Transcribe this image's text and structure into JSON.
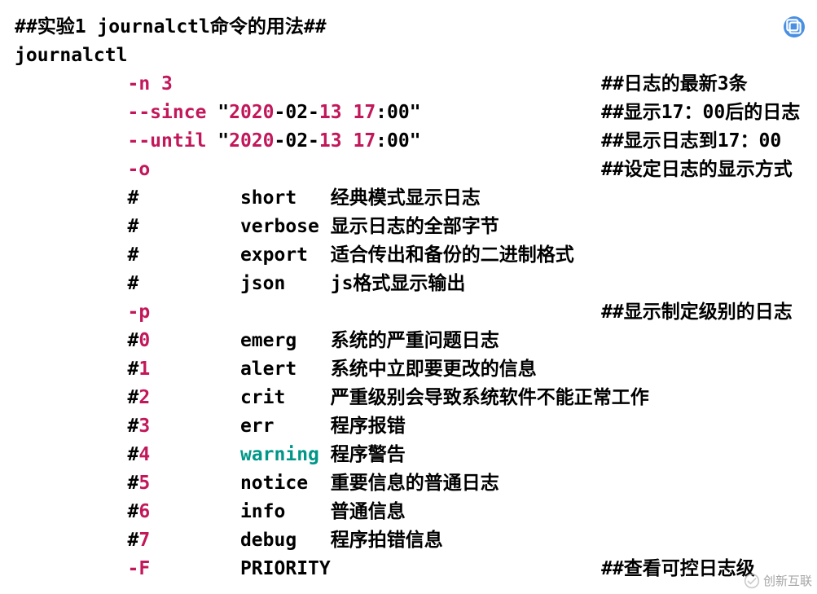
{
  "title_line": "##实验1 journalctl命令的用法##",
  "cmd": "journalctl",
  "indent": "          ",
  "col2_pad": "        ",
  "col3_start_pad": "",
  "rows": {
    "n": {
      "flag": "-n",
      "arg": "3",
      "comment": "##日志的最新3条"
    },
    "since": {
      "flag": "--since",
      "year": "2020",
      "mid": "-02-",
      "day": "13",
      "hour": "17",
      "rest": ":00",
      "comment": "##显示17：00后的日志"
    },
    "until": {
      "flag": "--until",
      "year": "2020",
      "mid": "-02-",
      "day": "13",
      "hour": "17",
      "rest": ":00",
      "comment": "##显示日志到17：00"
    },
    "o": {
      "flag": "-o",
      "comment": "##设定日志的显示方式"
    },
    "fmt": [
      {
        "key": "#",
        "name": "short",
        "desc": "经典模式显示日志"
      },
      {
        "key": "#",
        "name": "verbose",
        "desc": "显示日志的全部字节"
      },
      {
        "key": "#",
        "name": "export",
        "desc": "适合传出和备份的二进制格式"
      },
      {
        "key": "#",
        "name": "json",
        "desc": "js格式显示输出"
      }
    ],
    "p": {
      "flag": "-p",
      "comment": "##显示制定级别的日志"
    },
    "levels": [
      {
        "hash": "#",
        "num": "0",
        "name": "emerg",
        "desc": "系统的严重问题日志"
      },
      {
        "hash": "#",
        "num": "1",
        "name": "alert",
        "desc": "系统中立即要更改的信息"
      },
      {
        "hash": "#",
        "num": "2",
        "name": "crit",
        "desc": "严重级别会导致系统软件不能正常工作"
      },
      {
        "hash": "#",
        "num": "3",
        "name": "err",
        "desc": "程序报错"
      },
      {
        "hash": "#",
        "num": "4",
        "name": "warning",
        "desc": "程序警告",
        "teal": true
      },
      {
        "hash": "#",
        "num": "5",
        "name": "notice",
        "desc": "重要信息的普通日志"
      },
      {
        "hash": "#",
        "num": "6",
        "name": "info",
        "desc": "普通信息"
      },
      {
        "hash": "#",
        "num": "7",
        "name": "debug",
        "desc": "程序拍错信息"
      }
    ],
    "F": {
      "flag": "-F",
      "name": "PRIORITY",
      "comment": "##查看可控日志级"
    }
  },
  "watermark": "创新互联"
}
